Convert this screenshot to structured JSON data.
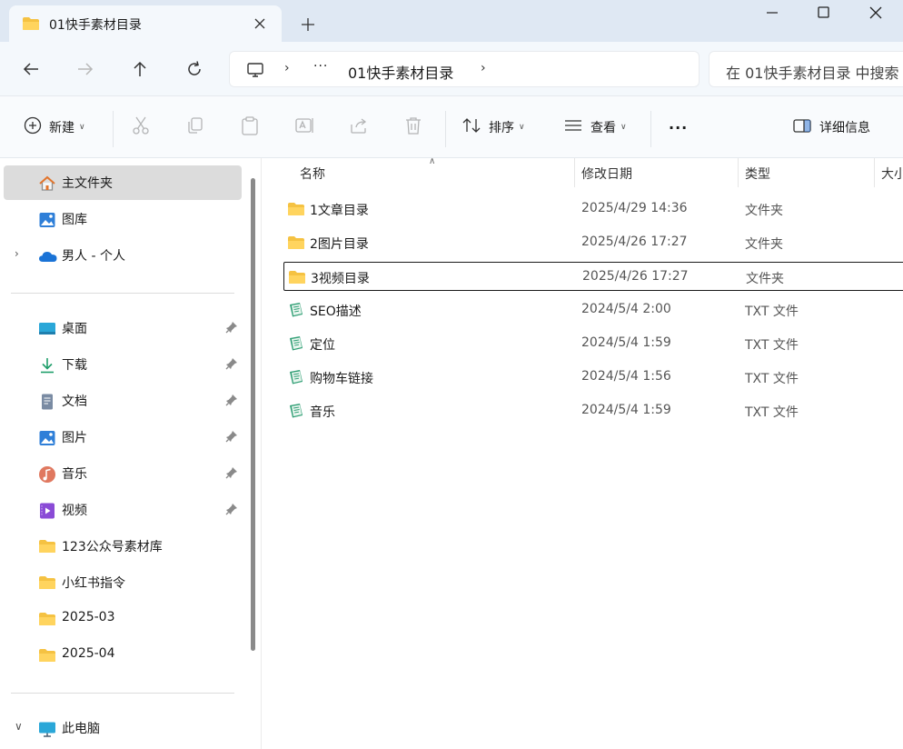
{
  "window": {
    "tab_title": "01快手素材目录"
  },
  "address": {
    "more": "···",
    "current_folder": "01快手素材目录",
    "search_placeholder": "在 01快手素材目录 中搜索"
  },
  "toolbar": {
    "new_label": "新建",
    "sort_label": "排序",
    "view_label": "查看",
    "more": "···",
    "details_label": "详细信息"
  },
  "sidebar": {
    "home": "主文件夹",
    "gallery": "图库",
    "onedrive": "男人 - 个人",
    "quick": [
      {
        "label": "桌面"
      },
      {
        "label": "下载"
      },
      {
        "label": "文档"
      },
      {
        "label": "图片"
      },
      {
        "label": "音乐"
      },
      {
        "label": "视频"
      },
      {
        "label": "123公众号素材库"
      },
      {
        "label": "小红书指令"
      },
      {
        "label": "2025-03"
      },
      {
        "label": "2025-04"
      }
    ],
    "this_pc": "此电脑"
  },
  "columns": {
    "name": "名称",
    "date": "修改日期",
    "type": "类型",
    "size": "大小"
  },
  "files": [
    {
      "name": "1文章目录",
      "date": "2025/4/29 14:36",
      "type": "文件夹",
      "kind": "folder"
    },
    {
      "name": "2图片目录",
      "date": "2025/4/26 17:27",
      "type": "文件夹",
      "kind": "folder"
    },
    {
      "name": "3视频目录",
      "date": "2025/4/26 17:27",
      "type": "文件夹",
      "kind": "folder"
    },
    {
      "name": "SEO描述",
      "date": "2024/5/4 2:00",
      "type": "TXT 文件",
      "kind": "txt"
    },
    {
      "name": "定位",
      "date": "2024/5/4 1:59",
      "type": "TXT 文件",
      "kind": "txt"
    },
    {
      "name": "购物车链接",
      "date": "2024/5/4 1:56",
      "type": "TXT 文件",
      "kind": "txt"
    },
    {
      "name": "音乐",
      "date": "2024/5/4 1:59",
      "type": "TXT 文件",
      "kind": "txt"
    }
  ],
  "colors": {
    "titlebar": "#dfe8f3",
    "folder": "#f5c242",
    "selection_border": "#1a1a1a",
    "active_nav": "#dcdcdc"
  }
}
